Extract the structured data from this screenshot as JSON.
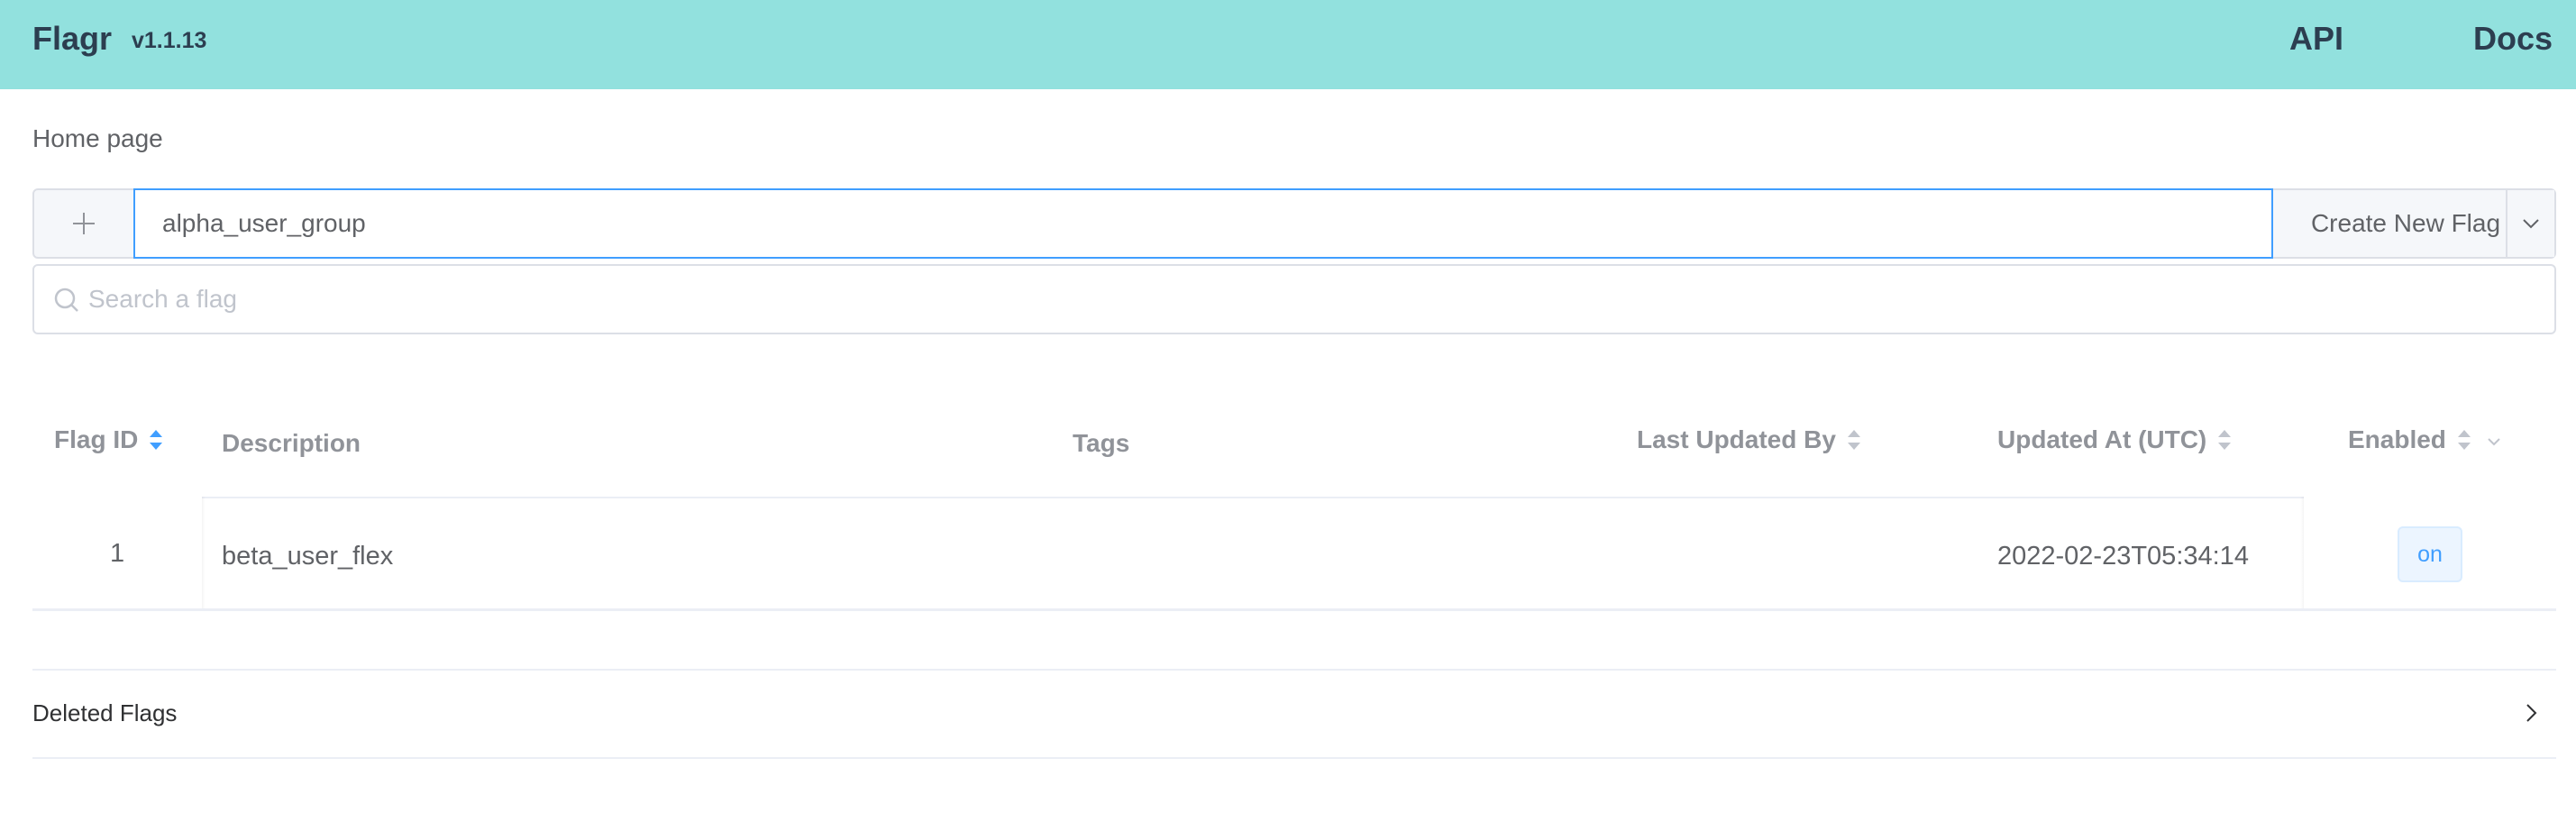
{
  "header": {
    "brand": "Flagr",
    "version": "v1.1.13",
    "nav": {
      "api": "API",
      "docs": "Docs"
    }
  },
  "breadcrumb": "Home page",
  "create_flag": {
    "value": "alpha_user_group",
    "button_label": "Create New Flag",
    "plus_icon": "plus-icon",
    "dropdown_icon": "chevron-down-icon"
  },
  "search": {
    "placeholder": "Search a flag",
    "icon": "search-icon"
  },
  "table": {
    "columns": {
      "flag_id": "Flag ID",
      "description": "Description",
      "tags": "Tags",
      "last_updated_by": "Last Updated By",
      "updated_at": "Updated At (UTC)",
      "enabled": "Enabled"
    },
    "sort_active_color": "#409eff",
    "rows": [
      {
        "flag_id": "1",
        "description": "beta_user_flex",
        "tags": "",
        "last_updated_by": "",
        "updated_at": "2022-02-23T05:34:14",
        "enabled": "on"
      }
    ]
  },
  "deleted_flags": {
    "title": "Deleted Flags",
    "icon": "chevron-right-icon"
  },
  "colors": {
    "header_bg": "#92e1de",
    "brand_text": "#2c3e50",
    "focus_border": "#409eff"
  }
}
